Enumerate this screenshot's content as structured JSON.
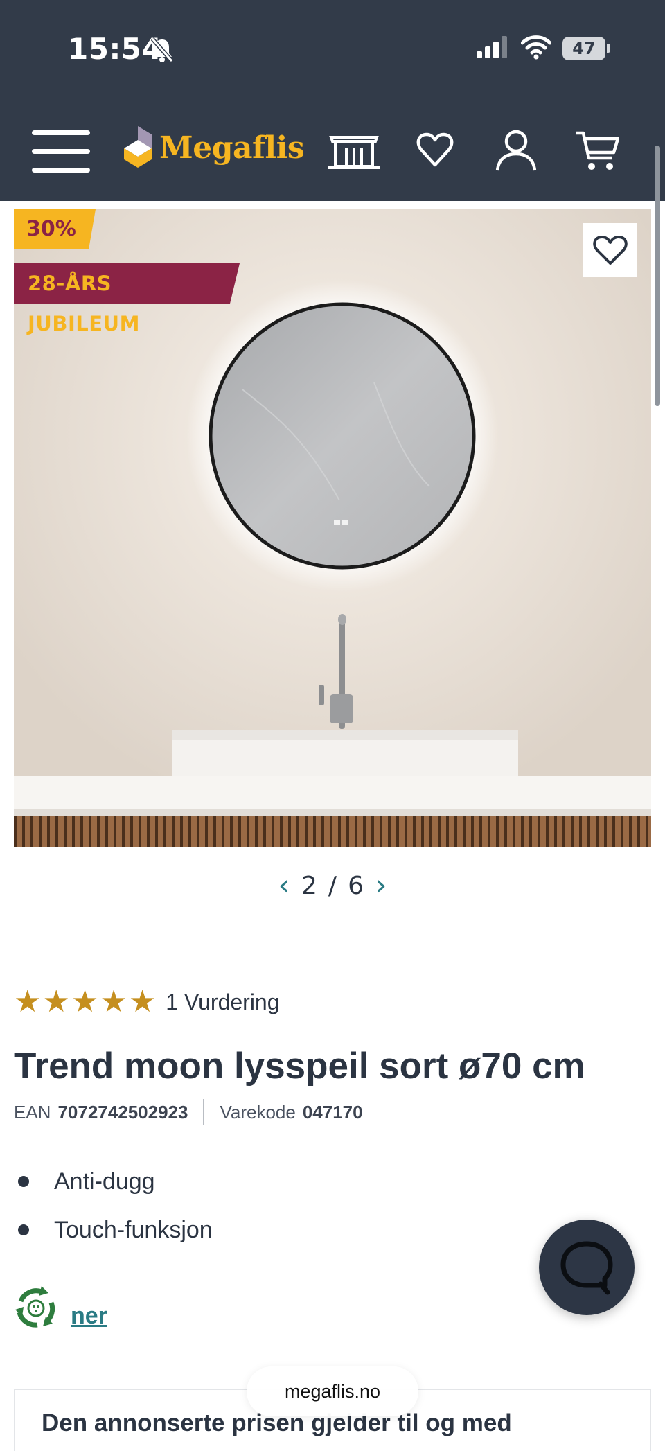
{
  "status_bar": {
    "time": "15:54",
    "battery": "47",
    "icons": [
      "bell-slash-icon",
      "signal-icon",
      "wifi-icon",
      "battery-icon"
    ]
  },
  "header": {
    "brand": "Megaflis",
    "icons": [
      "menu-icon",
      "store-icon",
      "heart-icon",
      "user-icon",
      "cart-icon"
    ],
    "colors": {
      "bar": "#323b49",
      "brand": "#f6b521"
    }
  },
  "product": {
    "discount_badge": "30%",
    "campaign_badge": "28-ÅRS JUBILEUM",
    "gallery": {
      "current": "2",
      "separator": "/",
      "total": "6"
    },
    "rating": {
      "stars": 5,
      "text": "1 Vurdering"
    },
    "title": "Trend moon lysspeil sort ø70 cm",
    "ean_label": "EAN",
    "ean": "7072742502923",
    "sku_label": "Varekode",
    "sku": "047170",
    "features": [
      "Anti-dugg",
      "Touch-funksjon"
    ],
    "more_link": "ner"
  },
  "notice": {
    "text": "Den annonserte prisen gjelder til og med"
  },
  "browser": {
    "url": "megaflis.no"
  },
  "colors": {
    "badge_yellow": "#f6b521",
    "badge_burgundy": "#8b2345",
    "star": "#c58f1f",
    "link": "#2a7b84"
  }
}
